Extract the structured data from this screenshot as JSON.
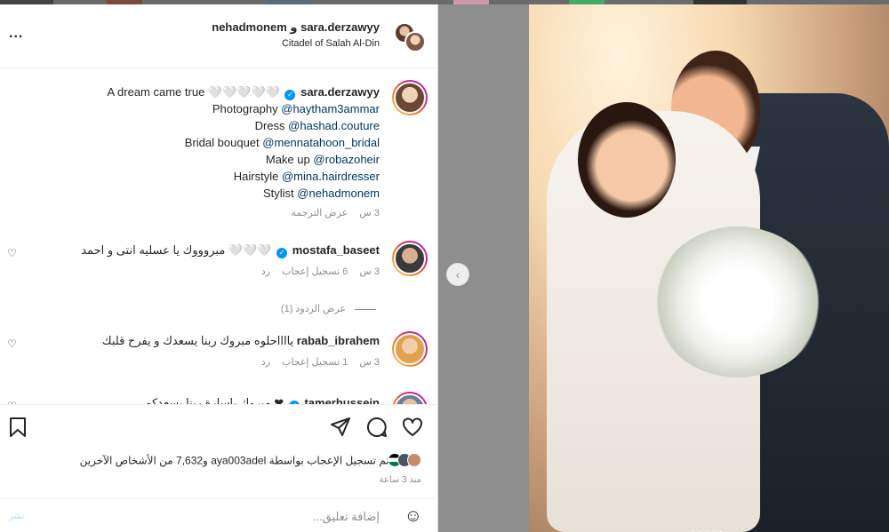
{
  "header": {
    "names": "nehadmonem و sara.derzawyy",
    "location": "Citadel of Salah Al-Din",
    "more_label": "..."
  },
  "caption": {
    "username": "sara.derzawyy",
    "text": "A dream came true 🤍🤍🤍🤍🤍",
    "photography_label": "Photography",
    "photography_handle": "@haytham3ammar",
    "dress_label": "Dress",
    "dress_handle": "@hashad.couture",
    "bouquet_label": "Bridal bouquet",
    "bouquet_handle": "@mennatahoon_bridal",
    "makeup_label": "Make up",
    "makeup_handle": "@robazoheir",
    "hair_label": "Hairstyle",
    "hair_handle": "@mina.hairdresser",
    "stylist_label": "Stylist",
    "stylist_handle": "@nehadmonem",
    "time": "3 س",
    "translate": "عرض الترجمة"
  },
  "comments": [
    {
      "username": "mostafa_baseet",
      "text": "مبروووك يا عسليه انتى و احمد 🤍🤍🤍",
      "time": "3 س",
      "likes": "6 تسجيل إعجاب",
      "reply": "رد"
    },
    {
      "username": "rabab_ibrahem",
      "text": "يااااحلوه مبروك ربنا يسعدك و يفرح قلبك",
      "time": "3 س",
      "likes": "1 تسجيل إعجاب",
      "reply": "رد"
    },
    {
      "username": "tamerhussein",
      "text": "مبروك ياسارة ربنا يسعدكم ❤",
      "time": "",
      "likes": "",
      "reply": ""
    }
  ],
  "view_replies": "عرض الردود (1)",
  "likes_summary": "تم تسجيل الإعجاب بواسطة aya003adel و7,632 من الأشخاص الآخرين",
  "time_ago": "منذ 3 ساعة",
  "add_comment_placeholder": "إضافة تعليق...",
  "post_label": "نشر",
  "colors": {
    "link": "#00376b",
    "verified": "#0095f6",
    "muted": "#8e8e8e"
  }
}
